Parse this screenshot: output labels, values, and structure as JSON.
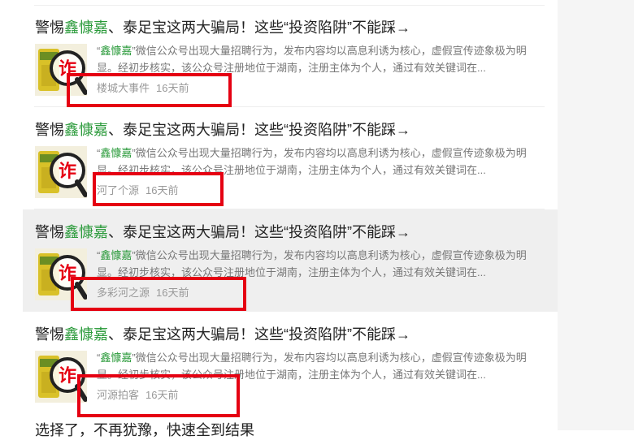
{
  "results": [
    {
      "title_pre": "警惕",
      "title_hl": "鑫慷嘉",
      "title_post": "、泰足宝这两大骗局！这些“投资陷阱”不能踩→",
      "snippet_quote_open": "“",
      "snippet_hl": "鑫慷嘉",
      "snippet_rest": "”微信公众号出现大量招聘行为，发布内容均以高息利诱为核心，虚假宣传迹象极为明显。经初步核实，该公众号注册地位于湖南，注册主体为个人，通过有效关键词在...",
      "source": "楼城大事件",
      "time": "16天前"
    },
    {
      "title_pre": "警惕",
      "title_hl": "鑫慷嘉",
      "title_post": "、泰足宝这两大骗局！这些“投资陷阱”不能踩→",
      "snippet_quote_open": "“",
      "snippet_hl": "鑫慷嘉",
      "snippet_rest": "”微信公众号出现大量招聘行为，发布内容均以高息利诱为核心，虚假宣传迹象极为明显。经初步核实，该公众号注册地位于湖南，注册主体为个人，通过有效关键词在...",
      "source": "河了个源",
      "time": "16天前"
    },
    {
      "title_pre": "警惕",
      "title_hl": "鑫慷嘉",
      "title_post": "、泰足宝这两大骗局！这些“投资陷阱”不能踩→",
      "snippet_quote_open": "“",
      "snippet_hl": "鑫慷嘉",
      "snippet_rest": "”微信公众号出现大量招聘行为，发布内容均以高息利诱为核心，虚假宣传迹象极为明显。经初步核实，该公众号注册地位于湖南，注册主体为个人，通过有效关键词在...",
      "source": "多彩河之源",
      "time": "16天前"
    },
    {
      "title_pre": "警惕",
      "title_hl": "鑫慷嘉",
      "title_post": "、泰足宝这两大骗局！这些“投资陷阱”不能踩→",
      "snippet_quote_open": "“",
      "snippet_hl": "鑫慷嘉",
      "snippet_rest": "”微信公众号出现大量招聘行为，发布内容均以高息利诱为核心，虚假宣传迹象极为明显。经初步核实，该公众号注册地位于湖南，注册主体为个人，通过有效关键词在...",
      "source": "河源拍客",
      "time": "16天前"
    }
  ],
  "thumbnail": {
    "icon": "magnifier-fraud-icon",
    "glyph": "诈"
  },
  "peek_title": "选择了，不再犹豫，快速全到结果",
  "colors": {
    "highlight": "#2a9a3a",
    "annotation_box": "#e50012",
    "hover_bg": "#efefef"
  }
}
